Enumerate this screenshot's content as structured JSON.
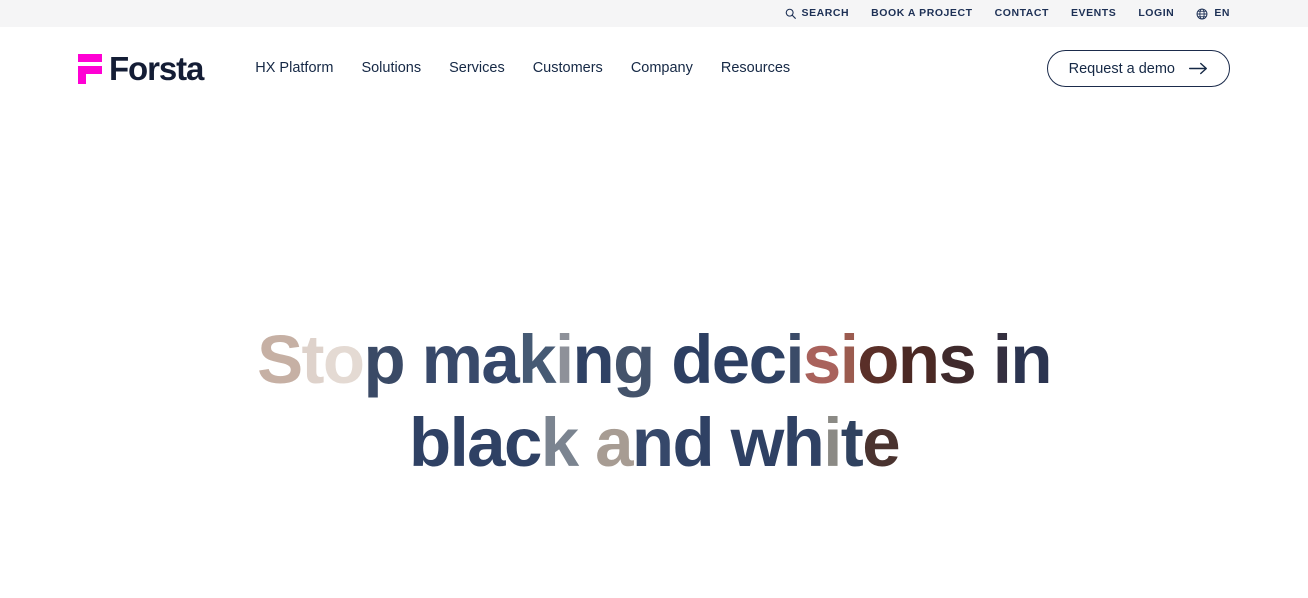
{
  "brand": {
    "name": "Forsta",
    "logo_mark_color": "#ff00d4",
    "wordmark_color": "#141d35"
  },
  "utility_bar": {
    "background": "#f5f5f6",
    "text_color": "#1d3055",
    "items": [
      {
        "label": "SEARCH",
        "icon": "search-icon"
      },
      {
        "label": "BOOK A PROJECT",
        "icon": null
      },
      {
        "label": "CONTACT",
        "icon": null
      },
      {
        "label": "EVENTS",
        "icon": null
      },
      {
        "label": "LOGIN",
        "icon": null
      },
      {
        "label": "EN",
        "icon": "globe-icon"
      }
    ]
  },
  "main_nav": {
    "items": [
      {
        "label": "HX Platform"
      },
      {
        "label": "Solutions"
      },
      {
        "label": "Services"
      },
      {
        "label": "Customers"
      },
      {
        "label": "Company"
      },
      {
        "label": "Resources"
      }
    ]
  },
  "cta": {
    "label": "Request a demo",
    "icon": "arrow-right-icon",
    "border_color": "#1b2b4b",
    "text_color": "#152845"
  },
  "hero": {
    "headline_plain": "Stop making decisions in black and white",
    "line_break_after_word": "in",
    "base_color": "#2e3e5c",
    "headline_segments": [
      {
        "text": "S",
        "color": "#c6b0a4"
      },
      {
        "text": "t",
        "color": "#ded2cb"
      },
      {
        "text": "o",
        "color": "#e4dad3"
      },
      {
        "text": "p",
        "color": "#3a4a66"
      },
      {
        "text": " ",
        "color": "#3a4a66"
      },
      {
        "text": "m",
        "color": "#38496a"
      },
      {
        "text": "a",
        "color": "#35476a"
      },
      {
        "text": "k",
        "color": "#465a74"
      },
      {
        "text": "i",
        "color": "#8e9199"
      },
      {
        "text": "n",
        "color": "#2f4164"
      },
      {
        "text": "g",
        "color": "#44536b"
      },
      {
        "text": " ",
        "color": "#2f4164"
      },
      {
        "text": "d",
        "color": "#2d3f62"
      },
      {
        "text": "e",
        "color": "#2d3f62"
      },
      {
        "text": "c",
        "color": "#2f4163"
      },
      {
        "text": "i",
        "color": "#3b4b68"
      },
      {
        "text": "s",
        "color": "#a9625c"
      },
      {
        "text": "i",
        "color": "#9b5b4f"
      },
      {
        "text": "o",
        "color": "#5a2f28"
      },
      {
        "text": "n",
        "color": "#4b2924"
      },
      {
        "text": "s",
        "color": "#3f2a2c"
      },
      {
        "text": " ",
        "color": "#2d3f62"
      },
      {
        "text": "i",
        "color": "#342f3f"
      },
      {
        "text": "n",
        "color": "#2b3450"
      },
      {
        "text": "\n",
        "color": "#2d3f62"
      },
      {
        "text": "b",
        "color": "#2f4164"
      },
      {
        "text": "l",
        "color": "#2f4164"
      },
      {
        "text": "a",
        "color": "#2f4164"
      },
      {
        "text": "c",
        "color": "#2f4164"
      },
      {
        "text": "k",
        "color": "#7b8490"
      },
      {
        "text": " ",
        "color": "#2f4164"
      },
      {
        "text": "a",
        "color": "#a79c93"
      },
      {
        "text": "n",
        "color": "#36486a"
      },
      {
        "text": "d",
        "color": "#2f4164"
      },
      {
        "text": " ",
        "color": "#2f4164"
      },
      {
        "text": "w",
        "color": "#2f4164"
      },
      {
        "text": "h",
        "color": "#2f4164"
      },
      {
        "text": "i",
        "color": "#8b8a85"
      },
      {
        "text": "t",
        "color": "#30425f"
      },
      {
        "text": "e",
        "color": "#4a332f"
      }
    ]
  }
}
